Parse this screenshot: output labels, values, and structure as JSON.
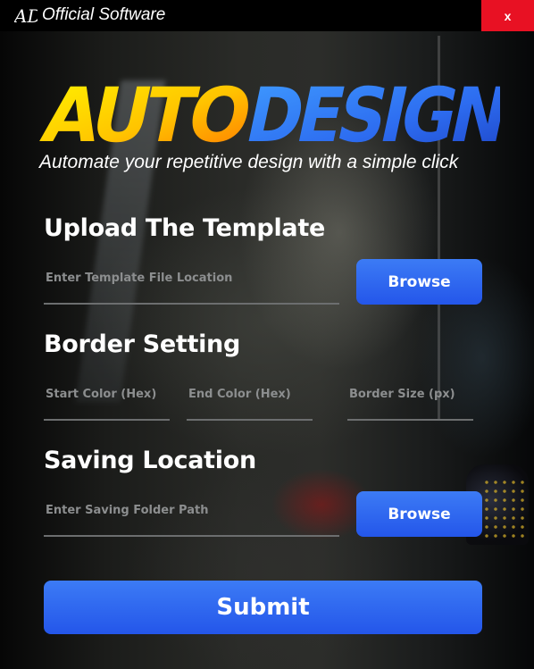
{
  "window": {
    "title": "Official Software",
    "brand_mark": "AD",
    "close_label": "x",
    "close_color": "#e81123"
  },
  "logo": {
    "word1": "AUTO",
    "word2": "DESIGN",
    "tagline": "Automate your repetitive design with a simple click"
  },
  "upload": {
    "title": "Upload The Template",
    "placeholder": "Enter Template File Location",
    "browse_label": "Browse"
  },
  "border": {
    "title": "Border Setting",
    "start_placeholder": "Start Color (Hex)",
    "end_placeholder": "End Color (Hex)",
    "size_placeholder": "Border Size (px)"
  },
  "saving": {
    "title": "Saving Location",
    "placeholder": "Enter Saving Folder Path",
    "browse_label": "Browse"
  },
  "submit": {
    "label": "Submit"
  },
  "colors": {
    "accent": "#2f6af0",
    "logo_warm": "#ffc400",
    "logo_cool": "#2d6cf0"
  }
}
